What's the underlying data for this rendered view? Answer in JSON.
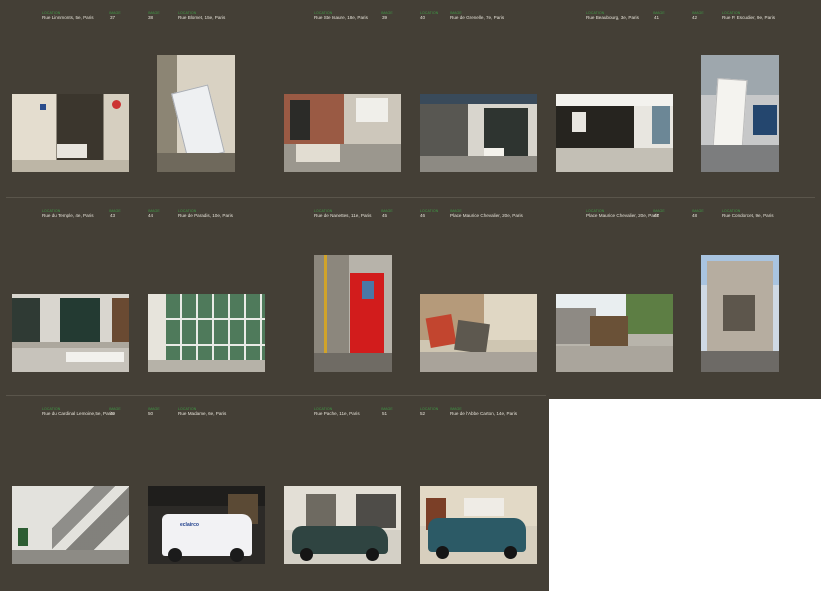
{
  "sheet": {
    "labels": {
      "location": "LOCATION",
      "image": "IMAGE"
    },
    "pages": [
      {
        "num": "37",
        "caption": "Rue Linnmonts, 5e, Paris"
      },
      {
        "num": "38",
        "caption": "Rue Blomet, 15e, Paris"
      },
      {
        "num": "39",
        "caption": "Rue Ste Isaure, 18e, Paris"
      },
      {
        "num": "40",
        "caption": "Rue de Grenelle, 7e, Paris"
      },
      {
        "num": "41",
        "caption": "Rue Beaubourg, 3e, Paris"
      },
      {
        "num": "42",
        "caption": "Rue P. Escudier, 9e, Paris"
      },
      {
        "num": "43",
        "caption": "Rue du Temple, 4e, Paris"
      },
      {
        "num": "44",
        "caption": "Rue de Paradis, 10e, Paris"
      },
      {
        "num": "45",
        "caption": "Rue de Nanettes, 11e, Paris"
      },
      {
        "num": "46",
        "caption": "Place Maurice Chevalier, 20e, Paris"
      },
      {
        "num": "47",
        "caption": "Place Maurice Chevalier, 20e, Paris"
      },
      {
        "num": "48",
        "caption": "Rue Condorcet, 9e, Paris"
      },
      {
        "num": "49",
        "caption": "Rue du Cardinal Lemoine,5e, Paris"
      },
      {
        "num": "50",
        "caption": "Rue Madame, 6e, Paris"
      },
      {
        "num": "51",
        "caption": "Rue Pache, 11e, Paris"
      },
      {
        "num": "52",
        "caption": "Rue de l'Abbe Carton, 14e, Paris"
      }
    ],
    "van_logo": "eclairco",
    "colors": {
      "background": "#443f36",
      "label_green": "#3f9a45",
      "caption": "#e6e2d8"
    }
  }
}
